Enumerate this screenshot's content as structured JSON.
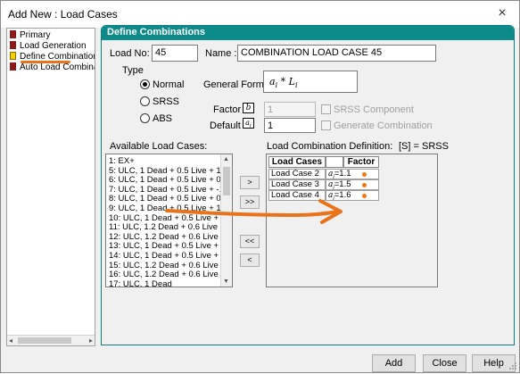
{
  "window": {
    "title": "Add New : Load Cases",
    "close_icon": "×"
  },
  "tree": {
    "items": [
      {
        "label": "Primary",
        "icon": "red"
      },
      {
        "label": "Load Generation",
        "icon": "red"
      },
      {
        "label": "Define Combinations",
        "icon": "yellow"
      },
      {
        "label": "Auto Load Combinat",
        "icon": "red"
      }
    ],
    "left_arrow": "◂",
    "right_arrow": "▸"
  },
  "panel": {
    "title": "Define Combinations",
    "load_no_label": "Load No:",
    "load_no_value": "45",
    "name_label": "Name :",
    "name_value": "COMBINATION LOAD CASE 45",
    "type_label": "Type",
    "type_options": [
      "Normal",
      "SRSS",
      "ABS"
    ],
    "type_selected": "Normal",
    "general_format_label": "General Format :",
    "formula_a": "a",
    "formula_i": "i",
    "formula_star": " * ",
    "formula_L": "L",
    "factor_label": "Factor",
    "factor_symbol": "b",
    "factor_value": "1",
    "default_label": "Default",
    "default_symbol": "a",
    "default_symbol_sub": "i",
    "default_value": "1",
    "srss_component_label": "SRSS Component",
    "generate_combination_label": "Generate Combination",
    "available_label": "Available Load Cases:",
    "definition_label": "Load Combination Definition:",
    "srss_note": "[S] = SRSS"
  },
  "available_load_cases": [
    "1: EX+",
    "5: ULC, 1 Dead + 0.5 Live + 1 Se",
    "6: ULC, 1 Dead + 0.5 Live + 0.2 \\",
    "7: ULC, 1 Dead + 0.5 Live + -1 S",
    "8: ULC, 1 Dead + 0.5 Live + 0.2 \\",
    "9: ULC, 1 Dead + 0.5 Live + 1.3",
    "10: ULC, 1 Dead + 0.5 Live + 0.2",
    "11: ULC, 1.2 Dead + 0.6 Live + 1",
    "12: ULC, 1.2 Dead + 0.6 Live + 0.",
    "13: ULC, 1 Dead + 0.5 Live + -1.",
    "14: ULC, 1 Dead + 0.5 Live + 0.2",
    "15: ULC, 1.2 Dead + 0.6 Live + -",
    "16: ULC, 1.2 Dead + 0.6 Live + 0",
    "17: ULC, 1 Dead"
  ],
  "transfer_buttons": {
    "add_one": ">",
    "add_all": ">>",
    "remove_all": "<<",
    "remove_one": "<"
  },
  "combination_table": {
    "headers": [
      "Load Cases",
      "",
      "Factor"
    ],
    "a_symbol": "a",
    "i_symbol": "i",
    "eq": "=",
    "rows": [
      {
        "load_case": "Load Case 2",
        "factor": "1.1"
      },
      {
        "load_case": "Load Case 3",
        "factor": "1.5"
      },
      {
        "load_case": "Load Case 4",
        "factor": "1.6"
      }
    ]
  },
  "footer": {
    "add_label": "Add",
    "close_label": "Close",
    "help_label": "Help"
  },
  "colors": {
    "panel_header": "#0d8b8b",
    "annotation": "#e8731a"
  }
}
